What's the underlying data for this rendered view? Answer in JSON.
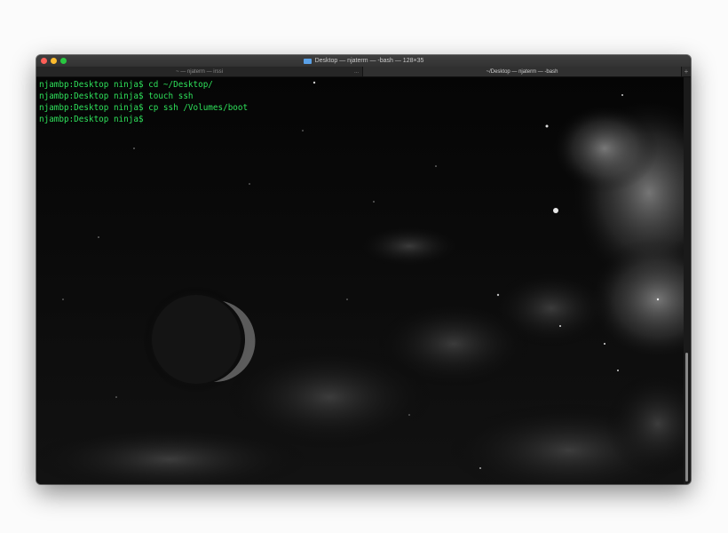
{
  "window": {
    "title": "Desktop — njaterm — -bash — 128×35",
    "traffic_lights": [
      {
        "name": "close",
        "color": "#ff5f57"
      },
      {
        "name": "minimize",
        "color": "#febc2e"
      },
      {
        "name": "zoom",
        "color": "#28c840"
      }
    ]
  },
  "tabs": [
    {
      "label": "~ — njaterm — irssi",
      "ellipsis": "..."
    },
    {
      "label": "~/Desktop — njaterm — -bash"
    }
  ],
  "tab_add_label": "+",
  "terminal": {
    "text_color": "#2ee05a",
    "lines": [
      "njambp:Desktop ninja$ cd ~/Desktop/",
      "njambp:Desktop ninja$ touch ssh",
      "njambp:Desktop ninja$ cp ssh /Volumes/boot",
      "njambp:Desktop ninja$"
    ]
  }
}
